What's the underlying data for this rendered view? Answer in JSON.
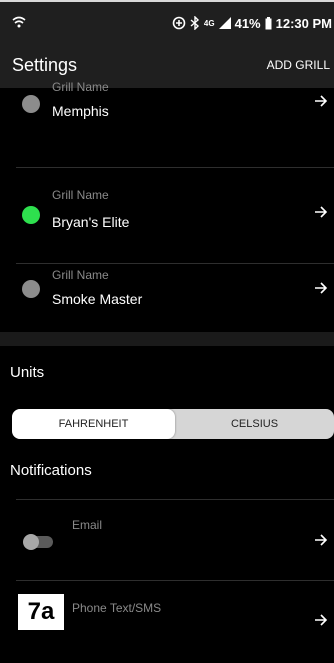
{
  "status_bar": {
    "battery": "41%",
    "time": "12:30 PM",
    "network": "4G"
  },
  "header": {
    "title": "Settings",
    "add_button": "ADD GRILL"
  },
  "grills": [
    {
      "caption": "Grill Name",
      "name": "Memphis",
      "status_color": "#8c8c8c"
    },
    {
      "caption": "Grill Name",
      "name": "Bryan's Elite",
      "status_color": "#2ee04e"
    },
    {
      "caption": "Grill Name",
      "name": "Smoke Master",
      "status_color": "#8c8c8c"
    }
  ],
  "units": {
    "title": "Units",
    "options": [
      "FAHRENHEIT",
      "CELSIUS"
    ],
    "selected": "FAHRENHEIT"
  },
  "notifications": {
    "title": "Notifications",
    "items": [
      {
        "label": "Email",
        "enabled": false
      },
      {
        "label": "Phone Text/SMS"
      }
    ]
  },
  "badge": "7a"
}
